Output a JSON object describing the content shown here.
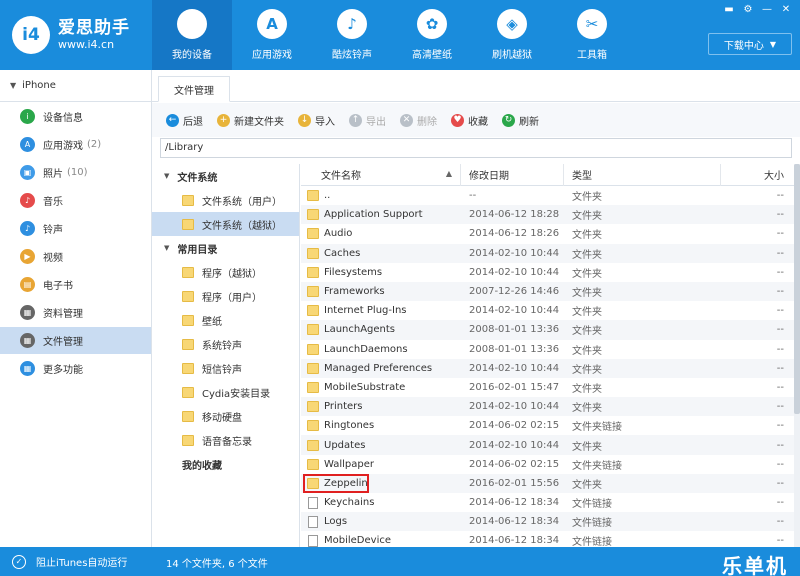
{
  "app": {
    "logo_badge": "i4",
    "name": "爱思助手",
    "url": "www.i4.cn"
  },
  "nav": [
    {
      "label": "我的设备",
      "icon": "apple-icon",
      "glyph": "",
      "active": true
    },
    {
      "label": "应用游戏",
      "icon": "app-store-icon",
      "glyph": "A"
    },
    {
      "label": "酷炫铃声",
      "icon": "bell-icon",
      "glyph": "♪"
    },
    {
      "label": "高清壁纸",
      "icon": "flower-icon",
      "glyph": "✿"
    },
    {
      "label": "刷机越狱",
      "icon": "dropbox-icon",
      "glyph": "◈"
    },
    {
      "label": "工具箱",
      "icon": "tools-icon",
      "glyph": "✂"
    }
  ],
  "window_controls": [
    "▬",
    "⚙",
    "—",
    "✕"
  ],
  "download_center": "下载中心",
  "device": {
    "name": "iPhone"
  },
  "sidebar": [
    {
      "label": "设备信息",
      "icon": "info-icon",
      "color": "#2aa74a",
      "glyph": "i"
    },
    {
      "label": "应用游戏",
      "count": "(2)",
      "icon": "app-icon",
      "color": "#2e8fe0",
      "glyph": "A"
    },
    {
      "label": "照片",
      "count": "(10)",
      "icon": "photo-icon",
      "color": "#3f9be8",
      "glyph": "▣"
    },
    {
      "label": "音乐",
      "icon": "music-icon",
      "color": "#e54b4b",
      "glyph": "♪"
    },
    {
      "label": "铃声",
      "icon": "bell-icon",
      "color": "#2e8fe0",
      "glyph": "♪"
    },
    {
      "label": "视频",
      "icon": "video-icon",
      "color": "#e8a534",
      "glyph": "▶"
    },
    {
      "label": "电子书",
      "icon": "book-icon",
      "color": "#e8a534",
      "glyph": "▤"
    },
    {
      "label": "资料管理",
      "icon": "data-icon",
      "color": "#666666",
      "glyph": "▦"
    },
    {
      "label": "文件管理",
      "icon": "folder-icon",
      "color": "#666666",
      "glyph": "▦",
      "active": true
    },
    {
      "label": "更多功能",
      "icon": "more-icon",
      "color": "#2e8fe0",
      "glyph": "▦"
    }
  ],
  "tab": "文件管理",
  "toolbar": [
    {
      "label": "后退",
      "icon": "back-icon",
      "color": "#1a8cdc",
      "glyph": "←"
    },
    {
      "label": "新建文件夹",
      "icon": "new-folder-icon",
      "color": "#e8b43a",
      "glyph": "+"
    },
    {
      "label": "导入",
      "icon": "import-icon",
      "color": "#e8b43a",
      "glyph": "↓"
    },
    {
      "label": "导出",
      "icon": "export-icon",
      "color": "#b9c0c8",
      "glyph": "↑",
      "disabled": true
    },
    {
      "label": "删除",
      "icon": "delete-icon",
      "color": "#b9c0c8",
      "glyph": "✕",
      "disabled": true
    },
    {
      "label": "收藏",
      "icon": "heart-icon",
      "color": "#e54b4b",
      "glyph": "♥"
    },
    {
      "label": "刷新",
      "icon": "refresh-icon",
      "color": "#2aa74a",
      "glyph": "↻"
    }
  ],
  "path": "/Library",
  "tree": {
    "filesystem_header": "文件系统",
    "filesystem_items": [
      {
        "label": "文件系统（用户）"
      },
      {
        "label": "文件系统（越狱）",
        "active": true
      }
    ],
    "common_header": "常用目录",
    "common_items": [
      {
        "label": "程序（越狱）"
      },
      {
        "label": "程序（用户）"
      },
      {
        "label": "壁纸"
      },
      {
        "label": "系统铃声"
      },
      {
        "label": "短信铃声"
      },
      {
        "label": "Cydia安装目录"
      },
      {
        "label": "移动硬盘"
      },
      {
        "label": "语音备忘录"
      }
    ],
    "favorites": "我的收藏"
  },
  "table": {
    "columns": {
      "name": "文件名称",
      "date": "修改日期",
      "type": "类型",
      "size": "大小"
    },
    "rows": [
      {
        "name": "..",
        "date": "--",
        "type": "文件夹",
        "size": "--",
        "kind": "folder"
      },
      {
        "name": "Application Support",
        "date": "2014-06-12 18:28",
        "type": "文件夹",
        "size": "--",
        "kind": "folder"
      },
      {
        "name": "Audio",
        "date": "2014-06-12 18:26",
        "type": "文件夹",
        "size": "--",
        "kind": "folder"
      },
      {
        "name": "Caches",
        "date": "2014-02-10 10:44",
        "type": "文件夹",
        "size": "--",
        "kind": "folder"
      },
      {
        "name": "Filesystems",
        "date": "2014-02-10 10:44",
        "type": "文件夹",
        "size": "--",
        "kind": "folder"
      },
      {
        "name": "Frameworks",
        "date": "2007-12-26 14:46",
        "type": "文件夹",
        "size": "--",
        "kind": "folder"
      },
      {
        "name": "Internet Plug-Ins",
        "date": "2014-02-10 10:44",
        "type": "文件夹",
        "size": "--",
        "kind": "folder"
      },
      {
        "name": "LaunchAgents",
        "date": "2008-01-01 13:36",
        "type": "文件夹",
        "size": "--",
        "kind": "folder"
      },
      {
        "name": "LaunchDaemons",
        "date": "2008-01-01 13:36",
        "type": "文件夹",
        "size": "--",
        "kind": "folder"
      },
      {
        "name": "Managed Preferences",
        "date": "2014-02-10 10:44",
        "type": "文件夹",
        "size": "--",
        "kind": "folder"
      },
      {
        "name": "MobileSubstrate",
        "date": "2016-02-01 15:47",
        "type": "文件夹",
        "size": "--",
        "kind": "folder"
      },
      {
        "name": "Printers",
        "date": "2014-02-10 10:44",
        "type": "文件夹",
        "size": "--",
        "kind": "folder"
      },
      {
        "name": "Ringtones",
        "date": "2014-06-02 02:15",
        "type": "文件夹链接",
        "size": "--",
        "kind": "folder"
      },
      {
        "name": "Updates",
        "date": "2014-02-10 10:44",
        "type": "文件夹",
        "size": "--",
        "kind": "folder"
      },
      {
        "name": "Wallpaper",
        "date": "2014-06-02 02:15",
        "type": "文件夹链接",
        "size": "--",
        "kind": "folder"
      },
      {
        "name": "Zeppelin",
        "date": "2016-02-01 15:56",
        "type": "文件夹",
        "size": "--",
        "kind": "folder",
        "highlighted": true
      },
      {
        "name": "Keychains",
        "date": "2014-06-12 18:34",
        "type": "文件链接",
        "size": "--",
        "kind": "file"
      },
      {
        "name": "Logs",
        "date": "2014-06-12 18:34",
        "type": "文件链接",
        "size": "--",
        "kind": "file"
      },
      {
        "name": "MobileDevice",
        "date": "2014-06-12 18:34",
        "type": "文件链接",
        "size": "--",
        "kind": "file"
      }
    ]
  },
  "status": {
    "itunes": "阻止iTunes自动运行",
    "summary": "14 个文件夹, 6 个文件",
    "watermark": "乐单机"
  }
}
